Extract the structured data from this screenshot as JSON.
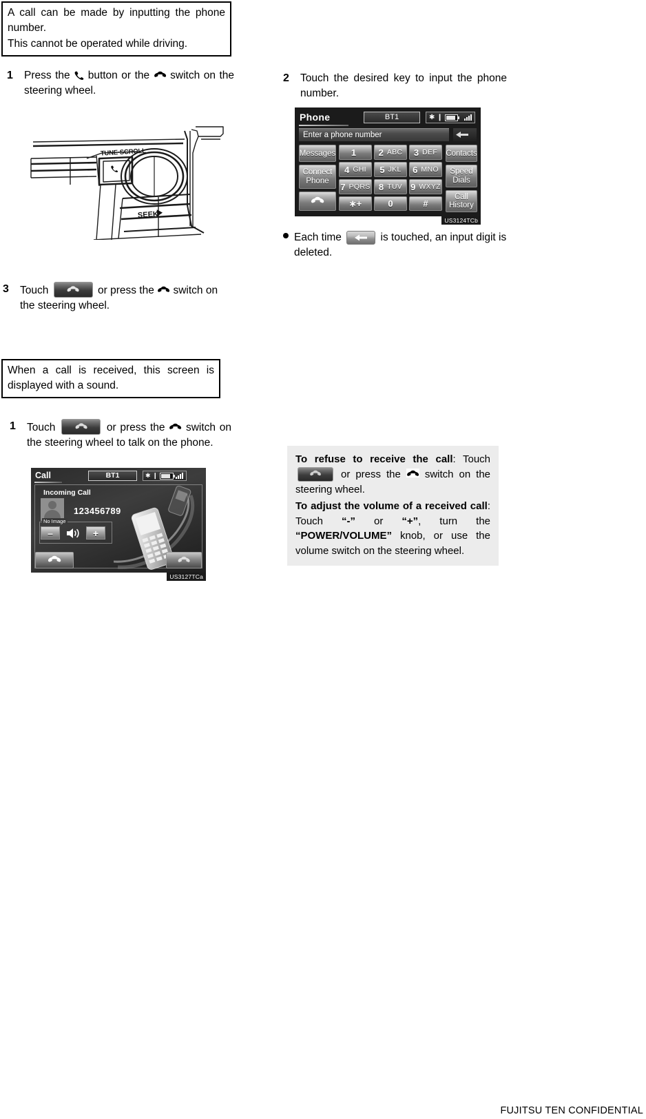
{
  "page": {
    "footer": "FUJITSU TEN CONFIDENTIAL"
  },
  "left_column": {
    "notice_making_call": {
      "line1": "A call can be made by inputting the phone number.",
      "line2": "This cannot be operated while driving."
    },
    "step1": {
      "number": "1",
      "text_before_phone_icon": "Press the",
      "text_between_icons": "button or the",
      "text_after_switch_icon": "switch on the steering wheel."
    },
    "head_unit_illustration": {
      "tune_scroll_label": "TUNE·SCROLL",
      "seek_label": "SEEK"
    },
    "step3": {
      "number": "3",
      "text_before_key": "Touch",
      "text_between": "or press the",
      "text_after": "switch on the steering wheel."
    },
    "notice_incoming_call": {
      "line1": "When a call is received, this screen is displayed with a sound."
    },
    "step1b": {
      "number": "1",
      "text_before_key": "Touch",
      "text_between": "or press the",
      "text_after": "switch on the steering wheel to talk on the phone."
    },
    "incoming_call_screen": {
      "title": "Call",
      "bt_label": "BT1",
      "incoming_label": "Incoming Call",
      "phone_number": "123456789",
      "no_image_label": "No Image",
      "volume_minus": "–",
      "volume_plus": "+",
      "image_code": "US3127TCa"
    }
  },
  "right_column": {
    "step2": {
      "number": "2",
      "text": "Touch the desired key to input the phone number."
    },
    "phone_keypad_screen": {
      "title": "Phone",
      "bt_label": "BT1",
      "entry_placeholder": "Enter a phone number",
      "left_keys": [
        "Messages",
        "Connect Phone"
      ],
      "right_keys": [
        "Contacts",
        "Speed Dials",
        "Call History"
      ],
      "keys": [
        {
          "digit": "1",
          "letters": ""
        },
        {
          "digit": "2",
          "letters": "ABC"
        },
        {
          "digit": "3",
          "letters": "DEF"
        },
        {
          "digit": "4",
          "letters": "GHI"
        },
        {
          "digit": "5",
          "letters": "JKL"
        },
        {
          "digit": "6",
          "letters": "MNO"
        },
        {
          "digit": "7",
          "letters": "PQRS"
        },
        {
          "digit": "8",
          "letters": "TUV"
        },
        {
          "digit": "9",
          "letters": "WXYZ"
        },
        {
          "digit": "∗+",
          "letters": ""
        },
        {
          "digit": "0",
          "letters": ""
        },
        {
          "digit": "#",
          "letters": ""
        }
      ],
      "image_code": "US3124TCb"
    },
    "bullet_delete": {
      "text_before_key": "Each time",
      "text_after_key": "is touched, an input digit is deleted."
    },
    "info_panel": {
      "refuse_bold": "To refuse to receive the call",
      "refuse_rest_1": ": Touch",
      "refuse_rest_2": "or press the",
      "refuse_rest_3": "switch on the steering wheel.",
      "volume_bold_1": "To adjust the volume of a received call",
      "volume_rest_1": ": Touch",
      "volume_quote_minus": "“-”",
      "volume_or": "or",
      "volume_quote_plus": "“+”",
      "volume_rest_2": ", turn the",
      "volume_knob_bold": "“POWER/VOLUME”",
      "volume_rest_3": "knob, or use the volume switch on the steering wheel."
    }
  },
  "colors": {
    "panel_bg": "#ececec",
    "screen_bg": "#1b1b1b",
    "text": "#000000"
  }
}
